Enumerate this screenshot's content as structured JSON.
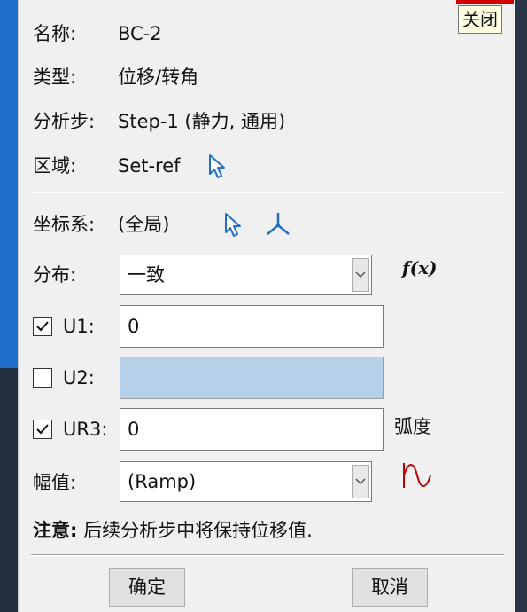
{
  "window": {
    "close_tooltip": "关闭"
  },
  "info": {
    "name_label": "名称:",
    "name_value": "BC-2",
    "type_label": "类型:",
    "type_value": "位移/转角",
    "step_label": "分析步:",
    "step_value": "Step-1 (静力, 通用)",
    "region_label": "区域:",
    "region_value": "Set-ref"
  },
  "csys": {
    "label": "坐标系:",
    "value": "(全局)"
  },
  "distribution": {
    "label": "分布:",
    "selected": "一致",
    "function_label": "f(x)"
  },
  "dofs": [
    {
      "label": "U1:",
      "checked": true,
      "value": "0"
    },
    {
      "label": "U2:",
      "checked": false,
      "value": ""
    },
    {
      "label": "UR3:",
      "checked": true,
      "value": "0",
      "unit": "弧度"
    }
  ],
  "amplitude": {
    "label": "幅值:",
    "selected": "(Ramp)"
  },
  "note": {
    "head": "注意:",
    "text": "后续分析步中将保持位移值."
  },
  "buttons": {
    "ok": "确定",
    "cancel": "取消"
  },
  "colors": {
    "accent_blue": "#1f6fc8",
    "amplitude_icon": "#c00000",
    "disabled_field": "#b7d0ea"
  }
}
